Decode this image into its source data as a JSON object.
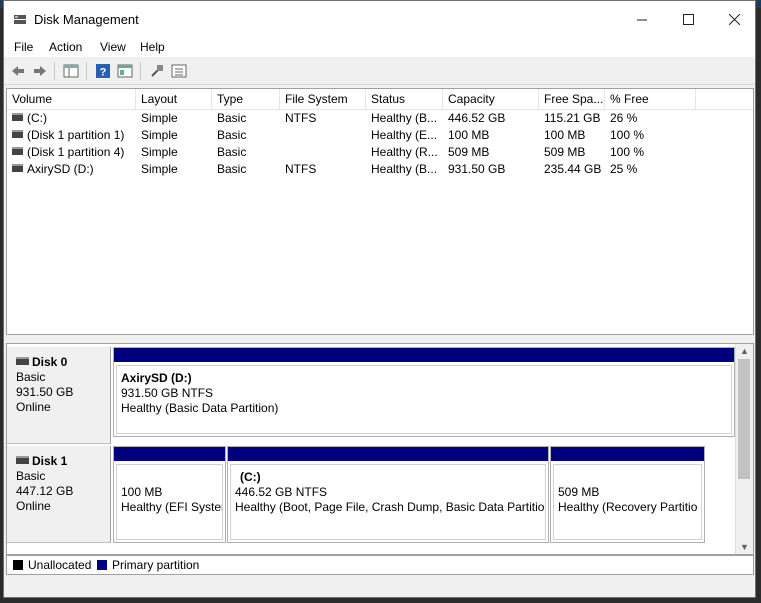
{
  "window": {
    "title": "Disk Management"
  },
  "menu": [
    "File",
    "Action",
    "View",
    "Help"
  ],
  "volume_list": {
    "columns": [
      "Volume",
      "Layout",
      "Type",
      "File System",
      "Status",
      "Capacity",
      "Free Spa...",
      "% Free"
    ],
    "rows": [
      [
        "(C:)",
        "Simple",
        "Basic",
        "NTFS",
        "Healthy (B...",
        "446.52 GB",
        "115.21 GB",
        "26 %"
      ],
      [
        "(Disk 1 partition 1)",
        "Simple",
        "Basic",
        "",
        "Healthy (E...",
        "100 MB",
        "100 MB",
        "100 %"
      ],
      [
        "(Disk 1 partition 4)",
        "Simple",
        "Basic",
        "",
        "Healthy (R...",
        "509 MB",
        "509 MB",
        "100 %"
      ],
      [
        "AxirySD (D:)",
        "Simple",
        "Basic",
        "NTFS",
        "Healthy (B...",
        "931.50 GB",
        "235.44 GB",
        "25 %"
      ]
    ]
  },
  "disks": [
    {
      "name": "Disk 0",
      "type": "Basic",
      "size": "931.50 GB",
      "state": "Online",
      "partitions": [
        {
          "title": "AxirySD  (D:)",
          "size_fs": "931.50 GB NTFS",
          "status": "Healthy (Basic Data Partition)"
        }
      ]
    },
    {
      "name": "Disk 1",
      "type": "Basic",
      "size": "447.12 GB",
      "state": "Online",
      "partitions": [
        {
          "title": "",
          "size_fs": "100 MB",
          "status": "Healthy (EFI Syster"
        },
        {
          "title": "(C:)",
          "size_fs": "446.52 GB NTFS",
          "status": "Healthy (Boot, Page File, Crash Dump, Basic Data Partition"
        },
        {
          "title": "",
          "size_fs": "509 MB",
          "status": "Healthy (Recovery Partitio"
        }
      ]
    }
  ],
  "legend": {
    "unallocated": {
      "label": "Unallocated",
      "color": "#000000"
    },
    "primary": {
      "label": "Primary partition",
      "color": "#00007f"
    }
  },
  "toolbar_icons": [
    "back-arrow-icon",
    "forward-arrow-icon",
    "console-tree-icon",
    "help-icon",
    "properties-icon",
    "connect-icon",
    "list-view-icon"
  ]
}
